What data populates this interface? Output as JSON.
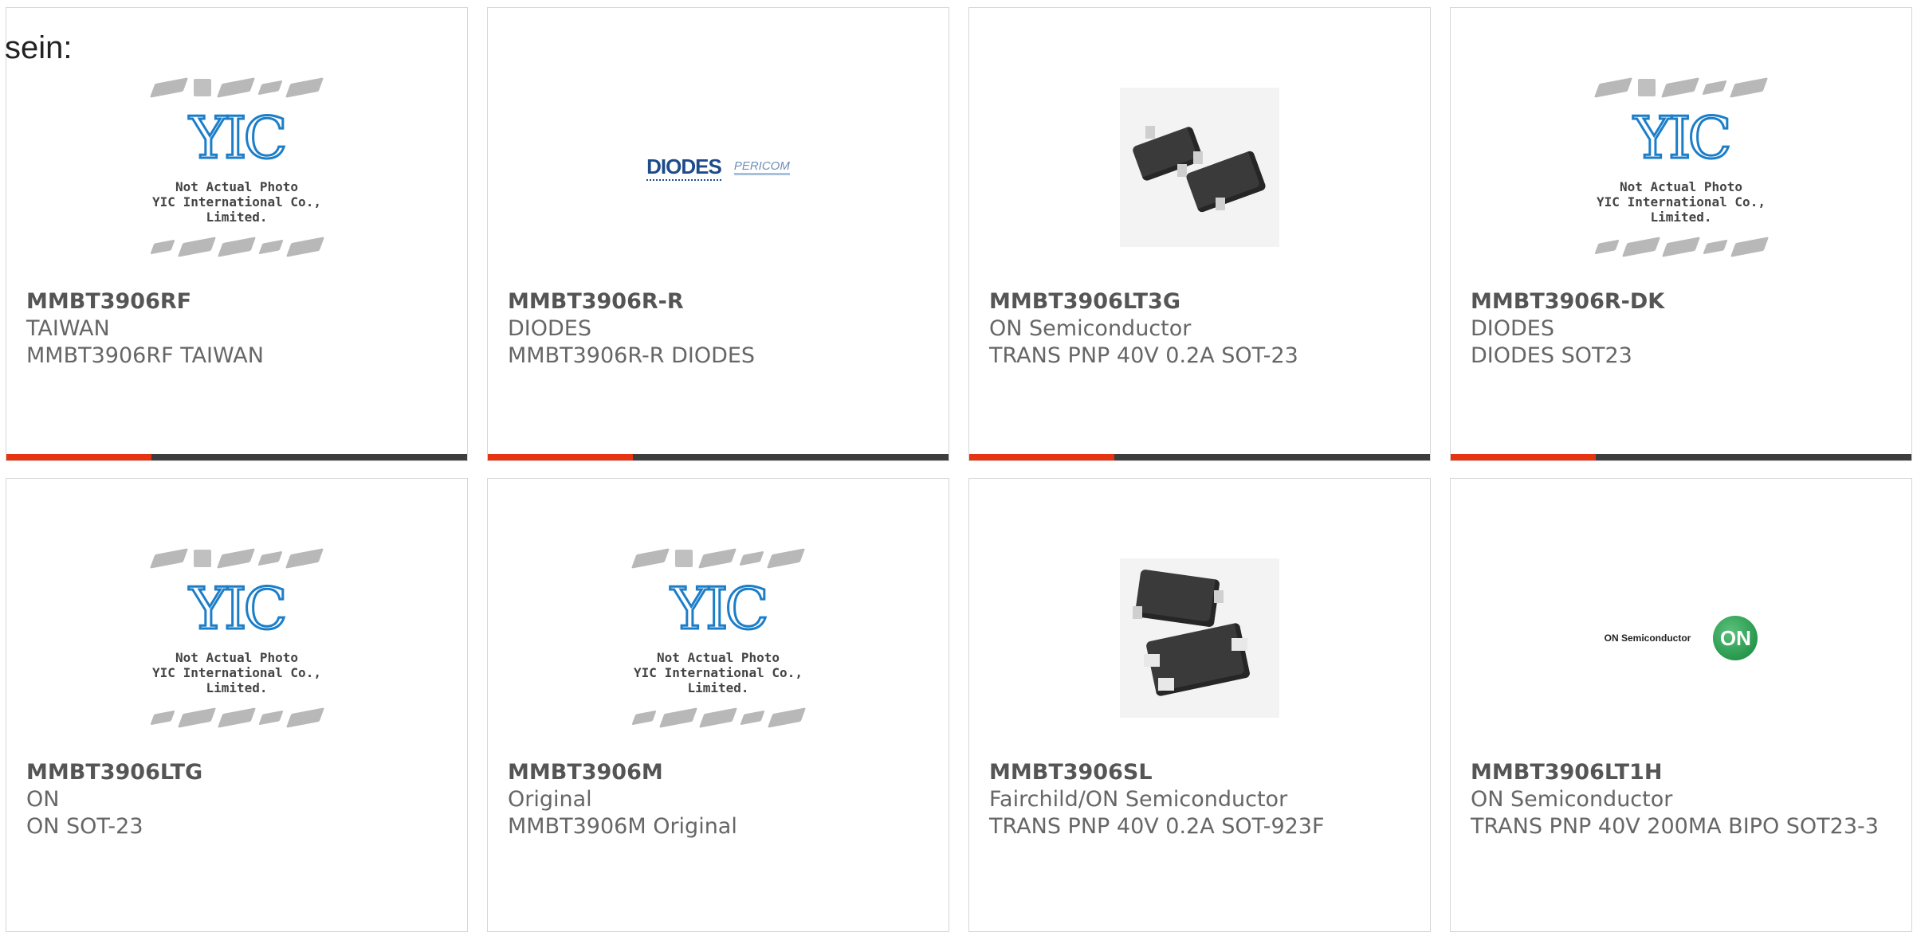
{
  "header": {
    "label": "sein:"
  },
  "products": [
    {
      "part": "MMBT3906RF",
      "maker": "TAIWAN",
      "desc": "MMBT3906RF TAIWAN",
      "image_type": "yic-placeholder",
      "image_caption": [
        "Not Actual Photo",
        "YIC International Co., Limited."
      ],
      "logo_text": "YIC"
    },
    {
      "part": "MMBT3906R-R",
      "maker": "DIODES",
      "desc": "MMBT3906R-R DIODES",
      "image_type": "diodes-logo",
      "logo_text": "DIODES",
      "logo_text_2": "PERICOM"
    },
    {
      "part": "MMBT3906LT3G",
      "maker": "ON Semiconductor",
      "desc": "TRANS PNP 40V 0.2A SOT-23",
      "image_type": "photo-sot23"
    },
    {
      "part": "MMBT3906R-DK",
      "maker": "DIODES",
      "desc": "DIODES SOT23",
      "image_type": "yic-placeholder",
      "image_caption": [
        "Not Actual Photo",
        "YIC International Co., Limited."
      ],
      "logo_text": "YIC"
    },
    {
      "part": "MMBT3906LTG",
      "maker": "ON",
      "desc": "ON SOT-23",
      "image_type": "yic-placeholder",
      "image_caption": [
        "Not Actual Photo",
        "YIC International Co., Limited."
      ],
      "logo_text": "YIC"
    },
    {
      "part": "MMBT3906M",
      "maker": "Original",
      "desc": "MMBT3906M Original",
      "image_type": "yic-placeholder",
      "image_caption": [
        "Not Actual Photo",
        "YIC International Co., Limited."
      ],
      "logo_text": "YIC"
    },
    {
      "part": "MMBT3906SL",
      "maker": "Fairchild/ON Semiconductor",
      "desc": "TRANS PNP 40V 0.2A SOT-923F",
      "image_type": "photo-sot923"
    },
    {
      "part": "MMBT3906LT1H",
      "maker": "ON Semiconductor",
      "desc": "TRANS PNP 40V 200MA BIPO SOT23-3",
      "image_type": "on-logo",
      "logo_text": "ON Semiconductor",
      "logo_badge": "ON"
    }
  ],
  "colors": {
    "accent": "#e63312",
    "bar": "#3d3d3d",
    "yic_blue": "#1d7ec8",
    "on_green": "#11873a"
  }
}
